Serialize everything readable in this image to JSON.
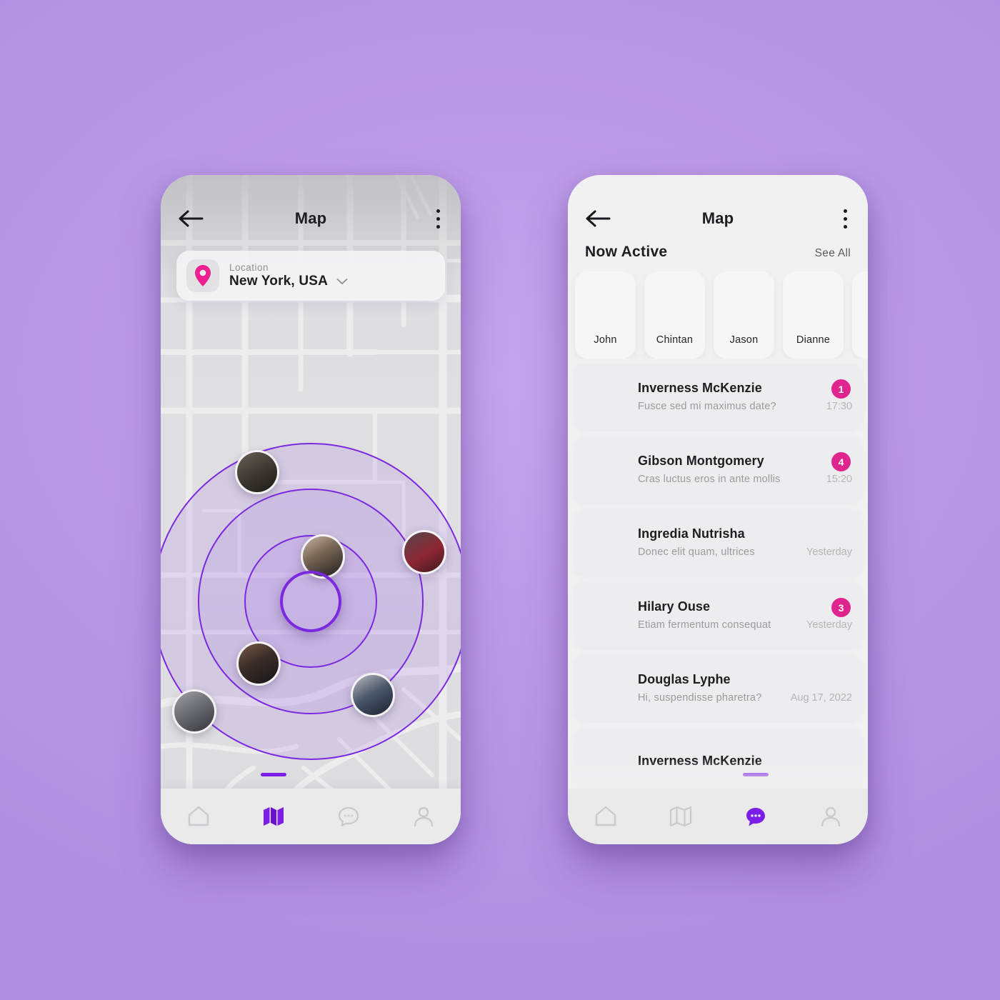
{
  "background_color": "#bb9ae8",
  "accent_purple": "#7c1ee8",
  "accent_pink": "#e0248e",
  "left_phone": {
    "header": {
      "title": "Map",
      "back_icon": "arrow-left-icon",
      "menu_icon": "kebab-menu-icon"
    },
    "location_card": {
      "icon": "map-pin-icon",
      "label": "Location",
      "value": "New York, USA",
      "chevron_icon": "chevron-down-icon"
    },
    "radar": {
      "center_user": "me",
      "nearby_users": [
        {
          "name": "nearby-user-1",
          "photo": "ph-m1"
        },
        {
          "name": "nearby-user-2",
          "photo": "ph-m2"
        },
        {
          "name": "nearby-user-3",
          "photo": "ph-m3"
        },
        {
          "name": "nearby-user-4",
          "photo": "ph-m4"
        },
        {
          "name": "nearby-user-5",
          "photo": "ph-m5"
        },
        {
          "name": "nearby-user-6",
          "photo": "ph-m6"
        }
      ]
    },
    "nav": {
      "active": "map",
      "items": [
        {
          "id": "home",
          "icon": "home-icon",
          "active": false
        },
        {
          "id": "map",
          "icon": "map-icon",
          "active": true
        },
        {
          "id": "chat",
          "icon": "chat-bubble-icon",
          "active": false
        },
        {
          "id": "profile",
          "icon": "person-icon",
          "active": false
        }
      ]
    }
  },
  "right_phone": {
    "header": {
      "title": "Map",
      "back_icon": "arrow-left-icon",
      "menu_icon": "kebab-menu-icon"
    },
    "now_active": {
      "title": "Now Active",
      "see_all": "See All",
      "users": [
        {
          "name": "John",
          "photo": "ph-john"
        },
        {
          "name": "Chintan",
          "photo": "ph-chintan"
        },
        {
          "name": "Jason",
          "photo": "ph-jason"
        },
        {
          "name": "Dianne",
          "photo": "ph-dianne"
        },
        {
          "name": "",
          "photo": "ph-p5"
        }
      ]
    },
    "chats": [
      {
        "name": "Inverness McKenzie",
        "message": "Fusce sed mi maximus date?",
        "time": "17:30",
        "badge": "1",
        "photo": "ph-inverness"
      },
      {
        "name": "Gibson Montgomery",
        "message": "Cras luctus eros in ante mollis",
        "time": "15:20",
        "badge": "4",
        "photo": "ph-gibson"
      },
      {
        "name": "Ingredia Nutrisha",
        "message": "Donec elit quam, ultrices",
        "time": "Yesterday",
        "badge": "",
        "photo": "ph-ingredia"
      },
      {
        "name": "Hilary Ouse",
        "message": "Etiam fermentum consequat",
        "time": "Yesterday",
        "badge": "3",
        "photo": "ph-hilary"
      },
      {
        "name": "Douglas Lyphe",
        "message": "Hi, suspendisse pharetra?",
        "time": "Aug 17, 2022",
        "badge": "",
        "photo": "ph-douglas"
      },
      {
        "name": "Inverness McKenzie",
        "message": "",
        "time": "",
        "badge": "",
        "photo": "ph-inverness2"
      }
    ],
    "nav": {
      "active": "chat",
      "items": [
        {
          "id": "home",
          "icon": "home-icon",
          "active": false
        },
        {
          "id": "map",
          "icon": "map-icon",
          "active": false
        },
        {
          "id": "chat",
          "icon": "chat-bubble-icon",
          "active": true
        },
        {
          "id": "profile",
          "icon": "person-icon",
          "active": false
        }
      ]
    }
  }
}
